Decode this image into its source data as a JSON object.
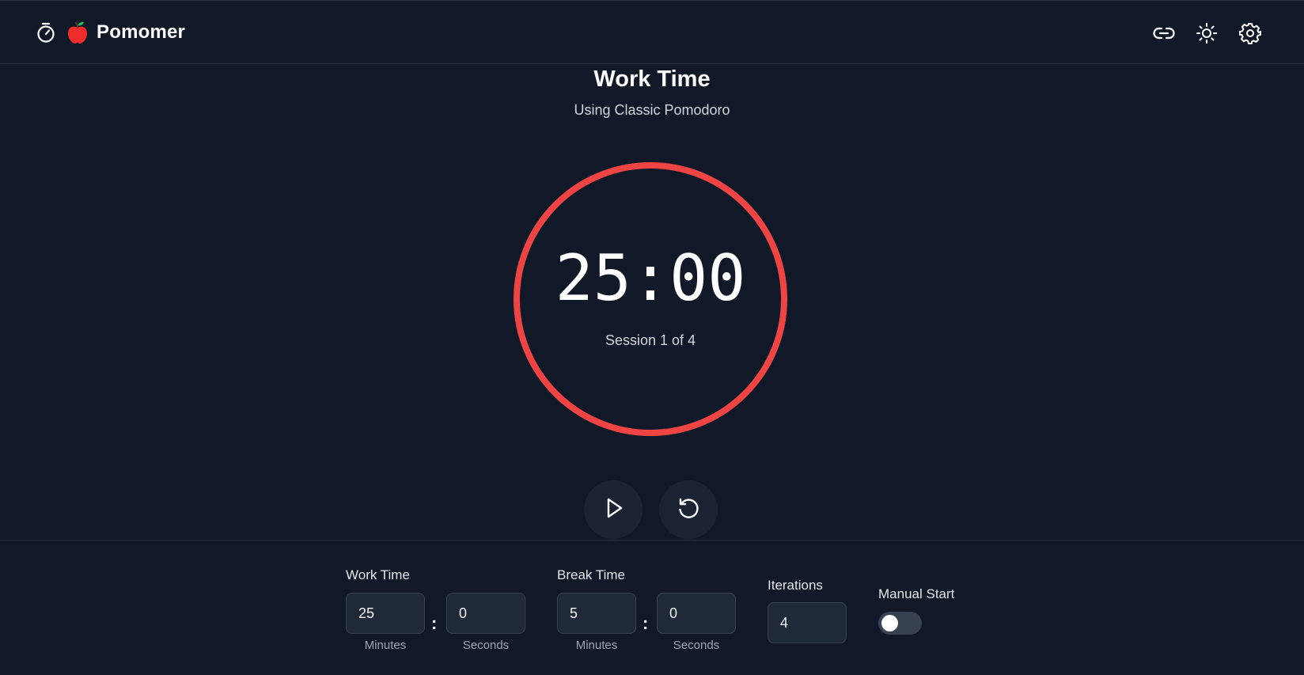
{
  "header": {
    "app_name": "Pomomer",
    "icons": [
      "timer-icon",
      "apple-logo-icon",
      "link-icon",
      "sun-icon",
      "gear-icon"
    ]
  },
  "timer": {
    "mode_title": "Work Time",
    "preset_text": "Using Classic Pomodoro",
    "display": "25:00",
    "session_text": "Session 1 of 4",
    "ring_color": "#ef4444"
  },
  "controls": {
    "icons": [
      "play-icon",
      "reset-icon"
    ]
  },
  "settings": {
    "work": {
      "label": "Work Time",
      "minutes": "25",
      "seconds": "0",
      "minutes_label": "Minutes",
      "seconds_label": "Seconds"
    },
    "break": {
      "label": "Break Time",
      "minutes": "5",
      "seconds": "0",
      "minutes_label": "Minutes",
      "seconds_label": "Seconds"
    },
    "iterations": {
      "label": "Iterations",
      "value": "4"
    },
    "manual_start": {
      "label": "Manual Start",
      "enabled": false
    },
    "separator": ":"
  },
  "colors": {
    "background": "#111827",
    "accent": "#ef4444",
    "input_bg": "#1f2937"
  }
}
